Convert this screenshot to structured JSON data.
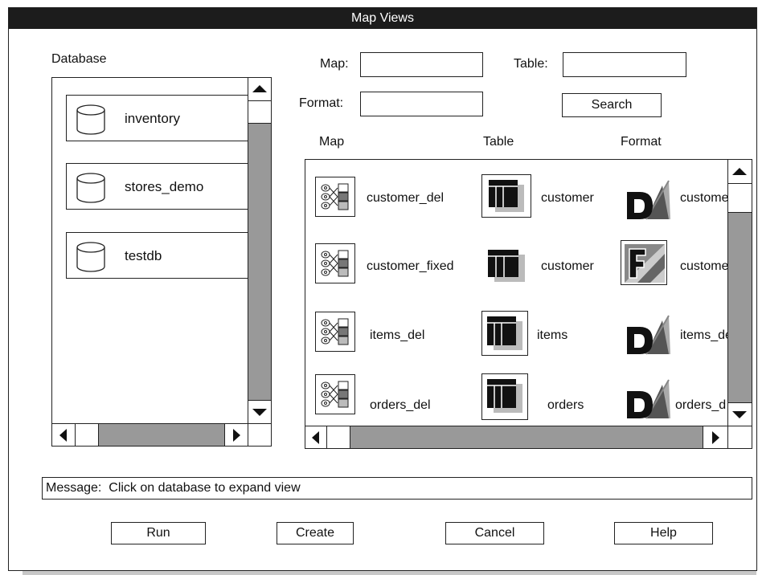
{
  "window": {
    "title": "Map Views"
  },
  "database": {
    "label": "Database",
    "items": [
      "inventory",
      "stores_demo",
      "testdb"
    ]
  },
  "search": {
    "map_label": "Map:",
    "map_value": "",
    "table_label": "Table:",
    "table_value": "",
    "format_label": "Format:",
    "format_value": "",
    "search_button": "Search"
  },
  "results": {
    "headers": [
      "Map",
      "Table",
      "Format"
    ],
    "rows": [
      {
        "map": "customer_del",
        "table": "customer",
        "format": "custome",
        "format_icon": "d-format-icon"
      },
      {
        "map": "customer_fixed",
        "table": "customer",
        "format": "custome",
        "format_icon": "f-format-icon"
      },
      {
        "map": "items_del",
        "table": "items",
        "format": "items_de",
        "format_icon": "d-format-icon"
      },
      {
        "map": "orders_del",
        "table": "orders",
        "format": "orders_d",
        "format_icon": "d-format-icon"
      }
    ]
  },
  "message": {
    "label": "Message:",
    "text": "Click on database to expand view"
  },
  "buttons": {
    "run": "Run",
    "create": "Create",
    "cancel": "Cancel",
    "help": "Help"
  },
  "colors": {
    "titlebar": "#1c1c1c",
    "scroll_track": "#999999",
    "shadow": "#c8c8c8"
  }
}
